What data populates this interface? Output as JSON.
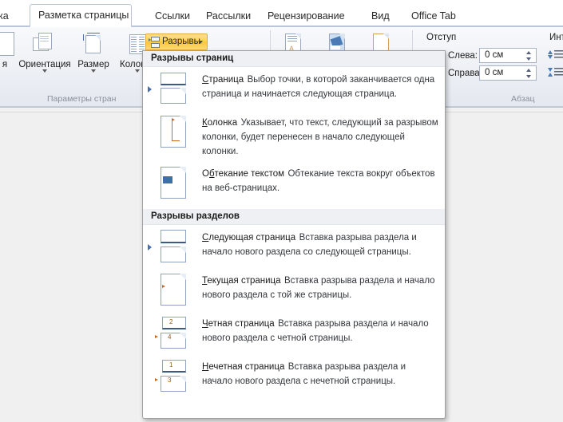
{
  "ribbon": {
    "tabs": [
      {
        "label": "ка",
        "active": false
      },
      {
        "label": "Разметка страницы",
        "active": true
      },
      {
        "label": "Ссылки",
        "active": false
      },
      {
        "label": "Рассылки",
        "active": false
      },
      {
        "label": "Рецензирование",
        "active": false
      },
      {
        "label": "Вид",
        "active": false
      },
      {
        "label": "Office Tab",
        "active": false
      }
    ],
    "page_setup": {
      "group_title": "Параметры стран",
      "commands": [
        {
          "label": "Ориентация",
          "icon": "orientation-icon"
        },
        {
          "label": "Размер",
          "icon": "size-icon"
        },
        {
          "label": "Колонки",
          "icon": "columns-icon"
        }
      ],
      "breaks_button": {
        "label": "Разрывы",
        "icon": "breaks-icon",
        "caret": "chevron-down-icon"
      }
    },
    "page_background": {
      "commands": [
        {
          "label": "",
          "icon": "watermark-icon"
        },
        {
          "label": "",
          "icon": "page-color-icon"
        },
        {
          "label": "",
          "icon": "page-borders-icon"
        }
      ]
    },
    "paragraph": {
      "group_title": "Абзац",
      "indent_label": "Отступ",
      "spacing_label": "Инт",
      "fields": [
        {
          "label": "Слева:",
          "value": "0 см"
        },
        {
          "label": "Справа:",
          "value": "0 см"
        }
      ]
    }
  },
  "menu": {
    "sections": [
      {
        "header": "Разрывы страниц",
        "items": [
          {
            "title": "Страница",
            "mnemonic": "С",
            "desc": "Выбор точки, в которой заканчивается одна страница и начинается следующая страница.",
            "icon": "page-break-icon",
            "bullet": true
          },
          {
            "title": "Колонка",
            "mnemonic": "К",
            "desc": "Указывает, что текст, следующий за разрывом колонки, будет перенесен в начало следующей колонки.",
            "icon": "column-break-icon",
            "bullet": false
          },
          {
            "title": "Обтекание текстом",
            "mnemonic": "б",
            "desc": "Обтекание текста вокруг объектов на веб-страницах.",
            "icon": "text-wrapping-break-icon",
            "bullet": false
          }
        ]
      },
      {
        "header": "Разрывы разделов",
        "items": [
          {
            "title": "Следующая страница",
            "mnemonic": "С",
            "desc": "Вставка разрыва раздела и начало нового раздела со следующей страницы.",
            "icon": "next-page-section-icon",
            "bullet": true
          },
          {
            "title": "Текущая страница",
            "mnemonic": "Т",
            "desc": "Вставка разрыва раздела и начало нового раздела с той же страницы.",
            "icon": "continuous-section-icon",
            "bullet": false
          },
          {
            "title": "Четная страница",
            "mnemonic": "Ч",
            "desc": "Вставка разрыва раздела и начало нового раздела с четной страницы.",
            "icon": "even-page-section-icon",
            "bullet": false,
            "page_numbers": [
              "2",
              "4"
            ]
          },
          {
            "title": "Нечетная страница",
            "mnemonic": "Н",
            "desc": "Вставка разрыва раздела и начало нового раздела с нечетной страницы.",
            "icon": "odd-page-section-icon",
            "bullet": false,
            "page_numbers": [
              "1",
              "3"
            ]
          }
        ]
      }
    ]
  },
  "colors": {
    "accent_highlight": "#ffd14f",
    "menu_header_bg": "#eef0f3",
    "bullet_blue": "#4a6fa8",
    "icon_orange": "#c8691d",
    "icon_blue": "#8fa3c0"
  }
}
